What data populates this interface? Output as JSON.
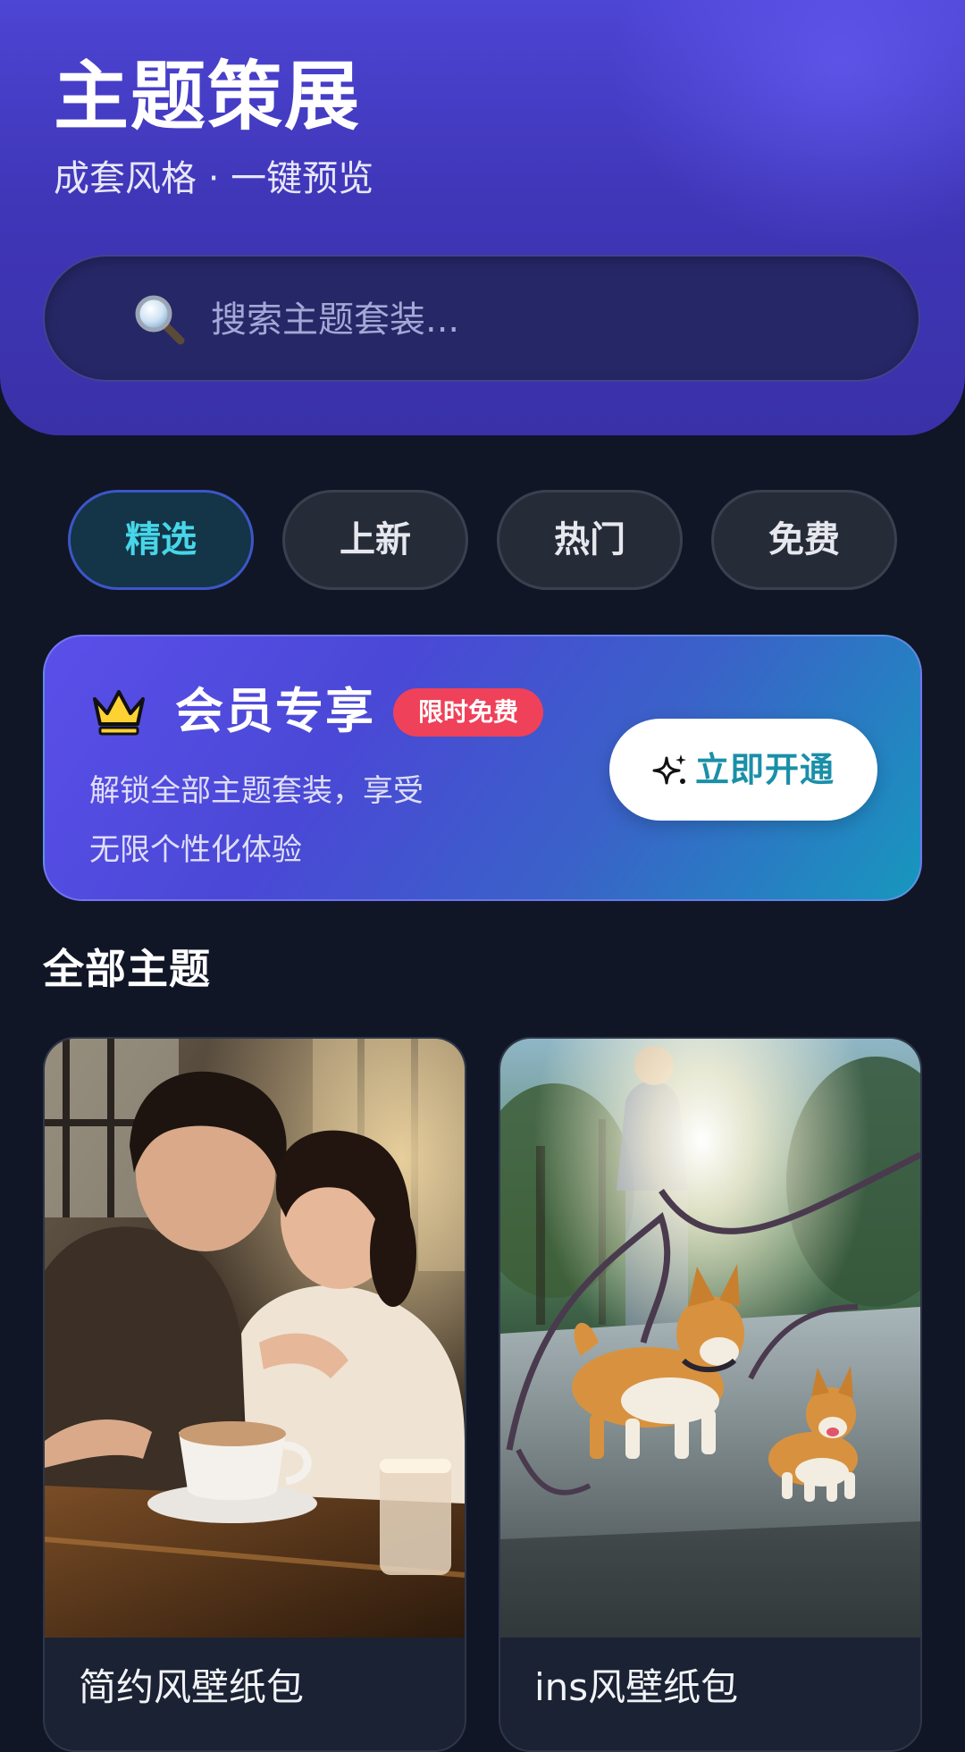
{
  "header": {
    "title": "主题策展",
    "subtitle": "成套风格 · 一键预览"
  },
  "search": {
    "placeholder": "搜索主题套装..."
  },
  "tabs": [
    {
      "label": "精选",
      "active": true
    },
    {
      "label": "上新",
      "active": false
    },
    {
      "label": "热门",
      "active": false
    },
    {
      "label": "免费",
      "active": false
    }
  ],
  "vip": {
    "title": "会员专享",
    "badge": "限时免费",
    "desc_line1": "解锁全部主题套装，享受",
    "desc_line2": "无限个性化体验",
    "cta_label": "立即开通",
    "icon": "crown-icon",
    "cta_icon": "sparkle-icon"
  },
  "section": {
    "title": "全部主题"
  },
  "themes": [
    {
      "name": "简约风壁纸包"
    },
    {
      "name": "ins风壁纸包"
    }
  ],
  "colors": {
    "accent": "#46d6e8",
    "header": "#4d45d4",
    "badge": "#ef4159",
    "background": "#101626"
  }
}
